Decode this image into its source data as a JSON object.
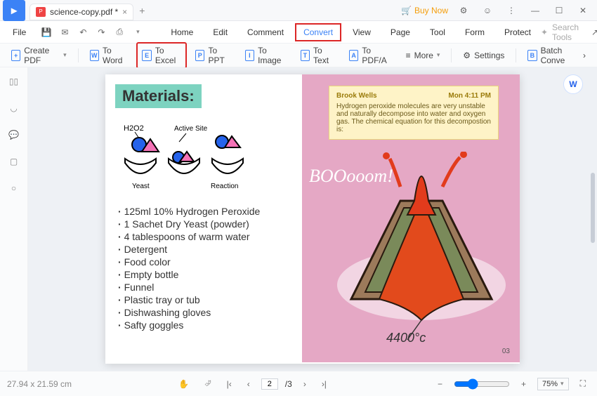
{
  "titlebar": {
    "filename": "science-copy.pdf *",
    "buy_now": "Buy Now"
  },
  "menubar": {
    "file": "File",
    "tabs": [
      "Home",
      "Edit",
      "Comment",
      "Convert",
      "View",
      "Page",
      "Tool",
      "Form",
      "Protect"
    ],
    "search_placeholder": "Search Tools"
  },
  "toolbar": {
    "create_pdf": "Create PDF",
    "to_word": "To Word",
    "to_excel": "To Excel",
    "to_ppt": "To PPT",
    "to_image": "To Image",
    "to_text": "To Text",
    "to_pdfa": "To PDF/A",
    "more": "More",
    "settings": "Settings",
    "batch_convert": "Batch Conve"
  },
  "document": {
    "materials_title": "Materials:",
    "diagram_labels": {
      "h2o2": "H2O2",
      "active_site": "Active Site",
      "yeast": "Yeast",
      "reaction": "Reaction"
    },
    "materials_list": [
      "125ml 10% Hydrogen Peroxide",
      "1 Sachet Dry Yeast (powder)",
      "4 tablespoons of warm water",
      "Detergent",
      "Food color",
      "Empty bottle",
      "Funnel",
      "Plastic tray or tub",
      "Dishwashing gloves",
      "Safty goggles"
    ],
    "note": {
      "author": "Brook Wells",
      "time": "Mon 4:11 PM",
      "body": "Hydrogen peroxide molecules are very unstable and naturally decompose into water and oxygen gas. The chemical equation for this decompostion is:"
    },
    "boom": "BOOooom!",
    "temperature": "4400°c",
    "page_label": "03"
  },
  "statusbar": {
    "dimensions": "27.94 x 21.59 cm",
    "page_current": "2",
    "page_total": "/3",
    "zoom": "75%"
  }
}
